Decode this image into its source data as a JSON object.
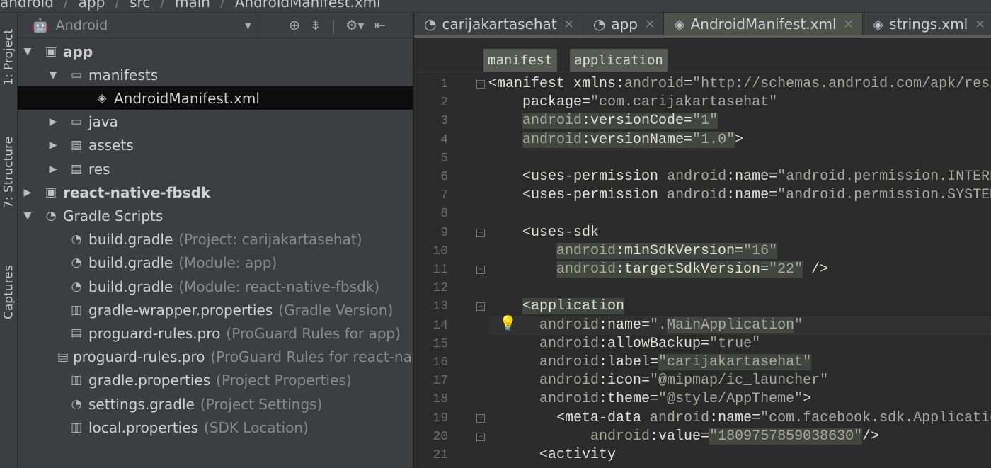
{
  "breadcrumb": [
    "android",
    "app",
    "src",
    "main",
    "AndroidManifest.xml"
  ],
  "side_tabs": [
    "1: Project",
    "7: Structure",
    "Captures"
  ],
  "project_panel": {
    "view_selector": "Android",
    "tools": [
      "locate-icon",
      "collapse-icon",
      "gear-icon",
      "hide-icon"
    ]
  },
  "tree": [
    {
      "label": "app",
      "bold": true,
      "depth": 0,
      "arrow": "down",
      "icon": "module-folder-icon"
    },
    {
      "label": "manifests",
      "depth": 1,
      "arrow": "down",
      "icon": "folder-icon"
    },
    {
      "label": "AndroidManifest.xml",
      "depth": 2,
      "arrow": "",
      "icon": "xml-file-icon",
      "selected": true
    },
    {
      "label": "java",
      "depth": 1,
      "arrow": "right",
      "icon": "folder-icon"
    },
    {
      "label": "assets",
      "depth": 1,
      "arrow": "right",
      "icon": "resource-folder-icon"
    },
    {
      "label": "res",
      "depth": 1,
      "arrow": "right",
      "icon": "resource-folder-icon"
    },
    {
      "label": "react-native-fbsdk",
      "bold": true,
      "depth": 0,
      "arrow": "right",
      "icon": "module-folder-icon"
    },
    {
      "label": "Gradle Scripts",
      "depth": 0,
      "arrow": "down",
      "icon": "gradle-icon"
    },
    {
      "label": "build.gradle",
      "hint": "(Project: carijakartasehat)",
      "depth": 1,
      "arrow": "",
      "icon": "gradle-icon"
    },
    {
      "label": "build.gradle",
      "hint": "(Module: app)",
      "depth": 1,
      "arrow": "",
      "icon": "gradle-icon"
    },
    {
      "label": "build.gradle",
      "hint": "(Module: react-native-fbsdk)",
      "depth": 1,
      "arrow": "",
      "icon": "gradle-icon"
    },
    {
      "label": "gradle-wrapper.properties",
      "hint": "(Gradle Version)",
      "depth": 1,
      "arrow": "",
      "icon": "properties-file-icon"
    },
    {
      "label": "proguard-rules.pro",
      "hint": "(ProGuard Rules for app)",
      "depth": 1,
      "arrow": "",
      "icon": "text-file-icon"
    },
    {
      "label": "proguard-rules.pro",
      "hint": "(ProGuard Rules for react-native-fbsdk)",
      "depth": 1,
      "arrow": "",
      "icon": "text-file-icon"
    },
    {
      "label": "gradle.properties",
      "hint": "(Project Properties)",
      "depth": 1,
      "arrow": "",
      "icon": "properties-file-icon"
    },
    {
      "label": "settings.gradle",
      "hint": "(Project Settings)",
      "depth": 1,
      "arrow": "",
      "icon": "gradle-icon"
    },
    {
      "label": "local.properties",
      "hint": "(SDK Location)",
      "depth": 1,
      "arrow": "",
      "icon": "properties-file-icon"
    }
  ],
  "editor_tabs": [
    {
      "label": "carijakartasehat",
      "icon": "gradle-icon"
    },
    {
      "label": "app",
      "icon": "gradle-icon"
    },
    {
      "label": "AndroidManifest.xml",
      "icon": "xml-file-icon",
      "active": true
    },
    {
      "label": "strings.xml",
      "icon": "xml-file-icon"
    }
  ],
  "tag_path": [
    "manifest",
    "application"
  ],
  "code": {
    "current_line": 14,
    "lines": [
      [
        [
          "tag",
          "<manifest "
        ],
        [
          "attr",
          "xmlns:"
        ],
        [
          "ns",
          "android"
        ],
        [
          "attr",
          "="
        ],
        [
          "val",
          "\"http://schemas.android.com/apk/res/android\""
        ]
      ],
      [
        [
          "sp",
          "    "
        ],
        [
          "attr",
          "package="
        ],
        [
          "val",
          "\"com.carijakartasehat\""
        ]
      ],
      [
        [
          "sp",
          "    "
        ],
        [
          "ns",
          "android",
          1
        ],
        [
          "attr",
          ":versionCode=",
          1
        ],
        [
          "val",
          "\"1\"",
          1
        ]
      ],
      [
        [
          "sp",
          "    "
        ],
        [
          "ns",
          "android",
          1
        ],
        [
          "attr",
          ":versionName=",
          1
        ],
        [
          "val",
          "\"1.0\"",
          1
        ],
        [
          "tag",
          ">"
        ]
      ],
      [],
      [
        [
          "sp",
          "    "
        ],
        [
          "tag",
          "<uses-permission "
        ],
        [
          "ns",
          "android"
        ],
        [
          "attr",
          ":name="
        ],
        [
          "val",
          "\"android.permission.INTERNET\""
        ],
        [
          "tag",
          " />"
        ]
      ],
      [
        [
          "sp",
          "    "
        ],
        [
          "tag",
          "<uses-permission "
        ],
        [
          "ns",
          "android"
        ],
        [
          "attr",
          ":name="
        ],
        [
          "val",
          "\"android.permission.SYSTEM_ALERT_WINDOW\""
        ],
        [
          "tag",
          "/>"
        ]
      ],
      [],
      [
        [
          "sp",
          "    "
        ],
        [
          "tag",
          "<uses-sdk"
        ]
      ],
      [
        [
          "sp",
          "        "
        ],
        [
          "ns",
          "android",
          1
        ],
        [
          "attr",
          ":minSdkVersion=",
          1
        ],
        [
          "val",
          "\"16\"",
          1
        ]
      ],
      [
        [
          "sp",
          "        "
        ],
        [
          "ns",
          "android",
          1
        ],
        [
          "attr",
          ":targetSdkVersion=",
          1
        ],
        [
          "val",
          "\"22\"",
          1
        ],
        [
          "tag",
          " />"
        ]
      ],
      [],
      [
        [
          "sp",
          "    "
        ],
        [
          "tag",
          "<application",
          1
        ]
      ],
      [
        [
          "sp",
          "      "
        ],
        [
          "ns",
          "android"
        ],
        [
          "attr",
          ":name="
        ],
        [
          "val",
          "\"."
        ],
        [
          "val",
          "MainApplication",
          1
        ],
        [
          "val",
          "\""
        ]
      ],
      [
        [
          "sp",
          "      "
        ],
        [
          "ns",
          "android"
        ],
        [
          "attr",
          ":allowBackup="
        ],
        [
          "val",
          "\"true\""
        ]
      ],
      [
        [
          "sp",
          "      "
        ],
        [
          "ns",
          "android"
        ],
        [
          "attr",
          ":label="
        ],
        [
          "val",
          "\"carijakartasehat\"",
          1
        ]
      ],
      [
        [
          "sp",
          "      "
        ],
        [
          "ns",
          "android"
        ],
        [
          "attr",
          ":icon="
        ],
        [
          "val",
          "\"@mipmap/ic_launcher\""
        ]
      ],
      [
        [
          "sp",
          "      "
        ],
        [
          "ns",
          "android"
        ],
        [
          "attr",
          ":theme="
        ],
        [
          "val",
          "\"@style/AppTheme\""
        ],
        [
          "tag",
          ">"
        ]
      ],
      [
        [
          "sp",
          "        "
        ],
        [
          "tag",
          "<meta-data "
        ],
        [
          "ns",
          "android"
        ],
        [
          "attr",
          ":name="
        ],
        [
          "val",
          "\"com.facebook.sdk.ApplicationId\""
        ]
      ],
      [
        [
          "sp",
          "            "
        ],
        [
          "ns",
          "android"
        ],
        [
          "attr",
          ":value="
        ],
        [
          "val",
          "\"1809757859038630\"",
          1
        ],
        [
          "tag",
          "/>"
        ]
      ],
      [
        [
          "sp",
          "      "
        ],
        [
          "tag",
          "<activity"
        ]
      ]
    ],
    "fold_lines": [
      1,
      9,
      11,
      13,
      19,
      20
    ]
  }
}
